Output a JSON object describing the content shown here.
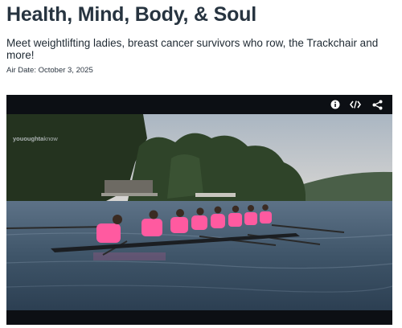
{
  "page": {
    "title": "Health, Mind, Body, & Soul",
    "subtitle": "Meet weightlifting ladies, breast cancer survivors who row, the Trackchair and more!",
    "air_date": "Air Date: October 3, 2025"
  },
  "player": {
    "watermark_bold": "yououghta",
    "watermark_light": "know",
    "controls": [
      {
        "icon": "info-icon"
      },
      {
        "icon": "embed-code-icon"
      },
      {
        "icon": "share-icon"
      }
    ],
    "scene": "rowing-crew-on-river"
  },
  "colors": {
    "title": "#273440",
    "player_bg": "#0c0f14",
    "shirt_pink": "#ff5aa0"
  }
}
